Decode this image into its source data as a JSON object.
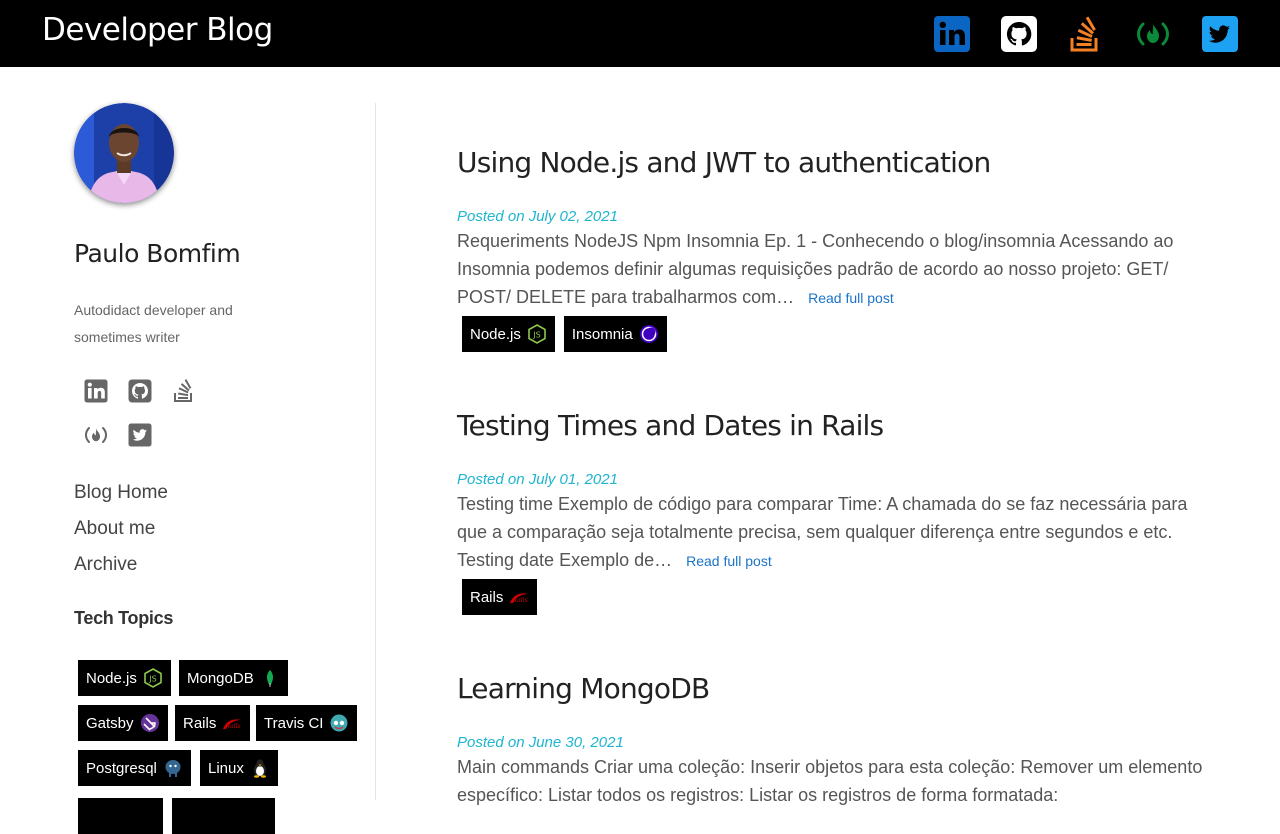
{
  "header": {
    "brand": "Developer Blog",
    "icons": [
      "linkedin-icon",
      "github-icon",
      "stackoverflow-icon",
      "freecodecamp-icon",
      "twitter-icon"
    ]
  },
  "profile": {
    "name": "Paulo Bomfim",
    "bio": "Autodidact developer and sometimes writer",
    "avatar": "profile-photo"
  },
  "social": [
    "linkedin-icon",
    "github-icon",
    "stackoverflow-icon",
    "freecodecamp-icon",
    "twitter-icon"
  ],
  "nav": [
    {
      "label": "Blog Home"
    },
    {
      "label": "About me"
    },
    {
      "label": "Archive"
    }
  ],
  "topics": {
    "title": "Tech Topics",
    "tags": [
      {
        "label": "Node.js",
        "icon": "nodejs-icon"
      },
      {
        "label": "MongoDB",
        "icon": "mongodb-icon"
      },
      {
        "label": "Gatsby",
        "icon": "gatsby-icon"
      },
      {
        "label": "Rails",
        "icon": "rails-icon"
      },
      {
        "label": "Travis CI",
        "icon": "travis-ci-icon"
      },
      {
        "label": "Postgresql",
        "icon": "postgresql-icon"
      },
      {
        "label": "Linux",
        "icon": "linux-icon"
      }
    ]
  },
  "posts": [
    {
      "title": "Using Node.js and JWT to authentication",
      "date": "Posted on July 02, 2021",
      "excerpt": "Requeriments NodeJS Npm Insomnia Ep. 1 - Conhecendo o blog/insomnia Acessando ao Insomnia podemos definir algumas requisições padrão de acordo ao nosso projeto: GET/ POST/ DELETE para trabalharmos com…",
      "read_more": "Read full post",
      "tags": [
        {
          "label": "Node.js",
          "icon": "nodejs-icon"
        },
        {
          "label": "Insomnia",
          "icon": "insomnia-icon"
        }
      ]
    },
    {
      "title": "Testing Times and Dates in Rails",
      "date": "Posted on July 01, 2021",
      "excerpt": "Testing time Exemplo de código para comparar Time: A chamada do se faz necessária para que a comparação seja totalmente precisa, sem qualquer diferença entre segundos e etc. Testing date Exemplo de…",
      "read_more": "Read full post",
      "tags": [
        {
          "label": "Rails",
          "icon": "rails-icon"
        }
      ]
    },
    {
      "title": "Learning MongoDB",
      "date": "Posted on June 30, 2021",
      "excerpt": "Main commands Criar uma coleção: Inserir objetos para esta coleção: Remover um elemento específico: Listar todos os registros: Listar os registros de forma formatada:",
      "read_more": "",
      "tags": []
    }
  ],
  "colors": {
    "header_bg": "#000000",
    "date": "#1fb5cf",
    "link": "#1a73c8",
    "linkedin": "#0a66c2",
    "stackoverflow": "#f48024",
    "freecodecamp": "#0a8a3a",
    "twitter": "#1da1f2"
  }
}
